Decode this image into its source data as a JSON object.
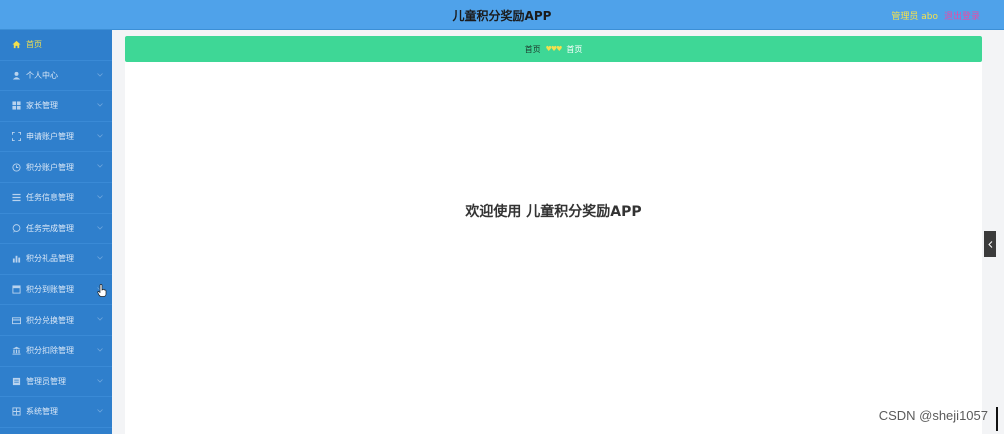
{
  "header": {
    "title": "儿童积分奖励APP",
    "admin_label": "管理员 abo",
    "logout_label": "退出登录"
  },
  "sidebar": {
    "items": [
      {
        "label": "首页",
        "icon": "home-icon",
        "active": true
      },
      {
        "label": "个人中心",
        "icon": "user-icon"
      },
      {
        "label": "家长管理",
        "icon": "grid-icon"
      },
      {
        "label": "申请账户管理",
        "icon": "frame-icon"
      },
      {
        "label": "积分账户管理",
        "icon": "clock-icon"
      },
      {
        "label": "任务信息管理",
        "icon": "list-icon"
      },
      {
        "label": "任务完成管理",
        "icon": "chat-icon"
      },
      {
        "label": "积分礼品管理",
        "icon": "bar-chart-icon"
      },
      {
        "label": "积分到账管理",
        "icon": "box-icon"
      },
      {
        "label": "积分兑换管理",
        "icon": "card-icon"
      },
      {
        "label": "积分扣除管理",
        "icon": "bank-icon"
      },
      {
        "label": "管理员管理",
        "icon": "doc-icon"
      },
      {
        "label": "系统管理",
        "icon": "settings-grid-icon"
      }
    ]
  },
  "breadcrumb": {
    "home": "首页",
    "separator": "♥♥♥",
    "current": "首页"
  },
  "main": {
    "welcome": "欢迎使用 儿童积分奖励APP"
  },
  "watermark": "CSDN @sheji1057",
  "colors": {
    "header": "#4fa2ea",
    "sidebar": "#2f7fcc",
    "breadcrumb": "#3ed796",
    "active_text": "#f3e04e",
    "logout": "#ea4aa6"
  }
}
